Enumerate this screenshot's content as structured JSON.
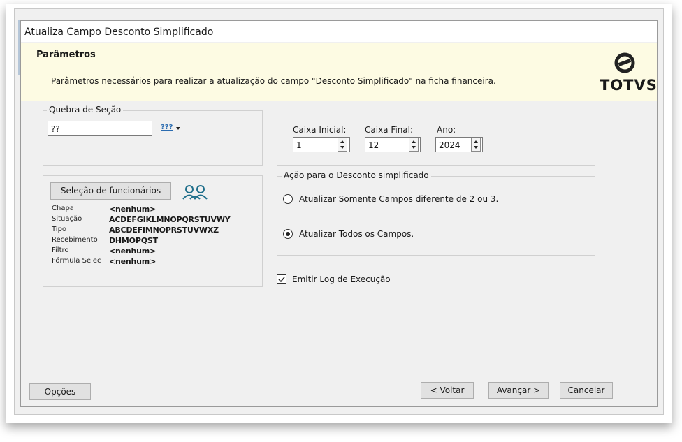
{
  "window": {
    "title": "Atualiza Campo Desconto Simplificado"
  },
  "header": {
    "title": "Parâmetros",
    "description": "Parâmetros necessários para realizar a atualização do campo \"Desconto Simplificado\" na ficha financeira.",
    "logo_text": "TOTVS"
  },
  "quebra": {
    "legend": "Quebra de Seção",
    "value": "??",
    "picker_icon_text": "???"
  },
  "caixa": {
    "inicial_label": "Caixa Inicial:",
    "inicial_value": "1",
    "final_label": "Caixa Final:",
    "final_value": "12",
    "ano_label": "Ano:",
    "ano_value": "2024"
  },
  "selecao": {
    "button_label": "Seleção de funcionários",
    "rows": [
      {
        "key": "Chapa",
        "value": "<nenhum>"
      },
      {
        "key": "Situação",
        "value": "ACDEFGIKLMNOPQRSTUVWY"
      },
      {
        "key": "Tipo",
        "value": "ABCDEFIMNOPRSTUVWXZ"
      },
      {
        "key": "Recebimento",
        "value": "DHMOPQST"
      },
      {
        "key": "Filtro",
        "value": "<nenhum>"
      },
      {
        "key": "Fórmula Selec",
        "value": "<nenhum>"
      }
    ]
  },
  "acao": {
    "legend": "Ação para o Desconto simplificado",
    "options": [
      {
        "label": "Atualizar Somente Campos diferente de 2 ou 3.",
        "checked": false
      },
      {
        "label": "Atualizar Todos os Campos.",
        "checked": true
      }
    ]
  },
  "log": {
    "label": "Emitir Log de Execução",
    "checked": true
  },
  "footer": {
    "opcoes": "Opções",
    "voltar": "< Voltar",
    "avancar": "Avançar >",
    "cancelar": "Cancelar"
  },
  "colors": {
    "header_bg": "#fdfbe3",
    "accent_blue": "#2b6cb0",
    "users_icon": "#1f6f8b"
  },
  "icons": {
    "logo": "totvs-logo-icon",
    "users": "users-group-icon",
    "picker": "section-picker-icon"
  }
}
